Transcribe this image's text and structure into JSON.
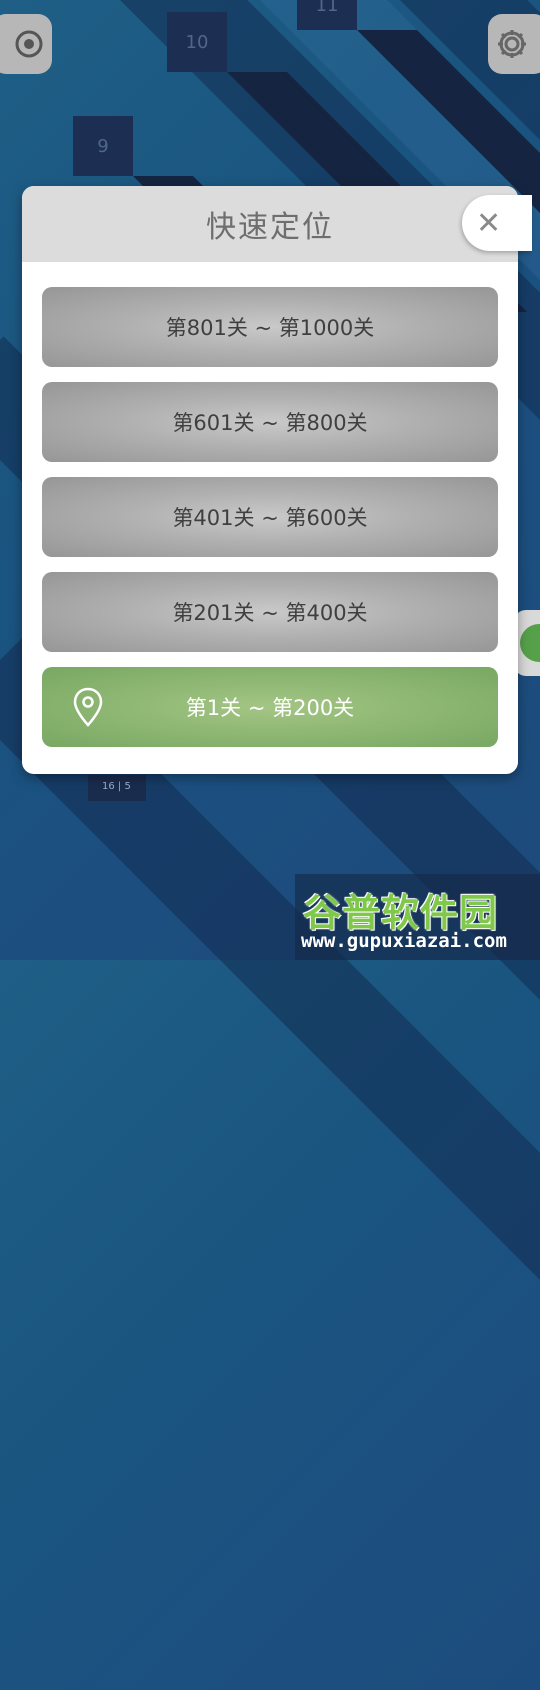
{
  "background_tiles": [
    {
      "number": "10"
    },
    {
      "number": "9"
    },
    {
      "number": "11"
    }
  ],
  "small_tile_label": "16 | 5",
  "modal": {
    "title": "快速定位",
    "close_symbol": "✕",
    "ranges": [
      {
        "label": "第801关 ~ 第1000关",
        "active": false
      },
      {
        "label": "第601关 ~ 第800关",
        "active": false
      },
      {
        "label": "第401关 ~ 第600关",
        "active": false
      },
      {
        "label": "第201关 ~ 第400关",
        "active": false
      },
      {
        "label": "第1关 ~ 第200关",
        "active": true,
        "icon": "location-pin-icon"
      }
    ]
  },
  "corner_buttons": {
    "left_icon": "target-icon",
    "right_icon": "gear-icon"
  },
  "watermark": {
    "title": "谷普软件园",
    "url": "www.gupuxiazai.com"
  },
  "colors": {
    "active_green": "#8fb874",
    "inactive_gray": "#b0b0b0",
    "header_gray": "#dcdcdc"
  }
}
